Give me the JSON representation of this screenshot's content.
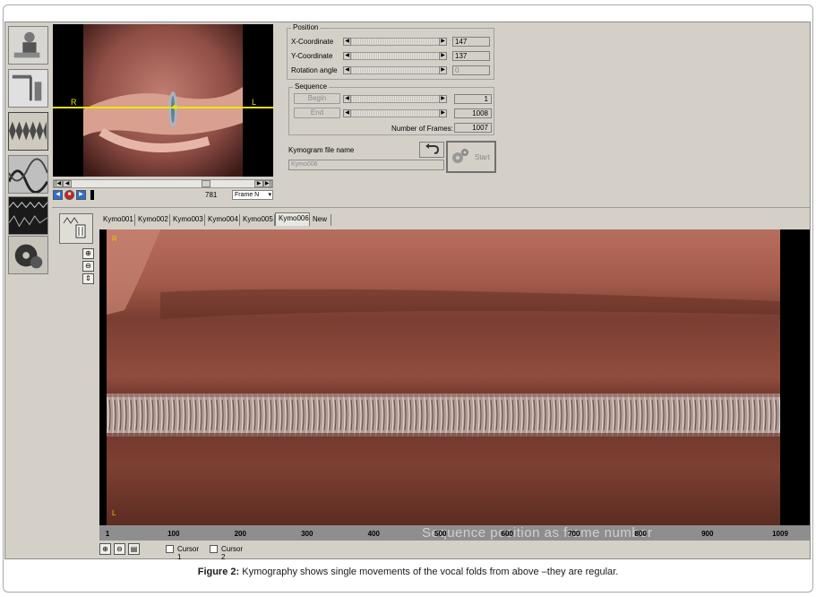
{
  "position": {
    "title": "Position",
    "x_label": "X-Coordinate",
    "x_value": "147",
    "y_label": "Y-Coordinate",
    "y_value": "137",
    "rot_label": "Rotation angle",
    "rot_value": "0"
  },
  "sequence": {
    "title": "Sequence",
    "begin_label": "Begin",
    "begin_value": "1",
    "end_label": "End",
    "end_value": "1008",
    "frames_label": "Number of Frames:",
    "frames_value": "1007"
  },
  "kymogram": {
    "file_label": "Kymogram file name",
    "file_value": "Kymo006",
    "start_label": "Start"
  },
  "video": {
    "left_marker": "R",
    "right_marker": "L",
    "frame_number": "781",
    "frame_mode": "Frame N"
  },
  "tabs": [
    "Kymo001",
    "Kymo002",
    "Kymo003",
    "Kymo004",
    "Kymo005",
    "Kymo006",
    "New"
  ],
  "active_tab": "Kymo006",
  "kymo_view": {
    "top_marker": "R",
    "bottom_marker": "L",
    "axis_label": "Sequence position as frame number",
    "ticks": [
      "1",
      "100",
      "200",
      "300",
      "400",
      "500",
      "600",
      "700",
      "800",
      "900",
      "1009"
    ]
  },
  "bottom": {
    "cursor1": "Cursor 1",
    "cursor2": "Cursor 2"
  },
  "caption": {
    "bold": "Figure 2:",
    "text": " Kymography shows single movements of the vocal folds from above –they are regular."
  }
}
